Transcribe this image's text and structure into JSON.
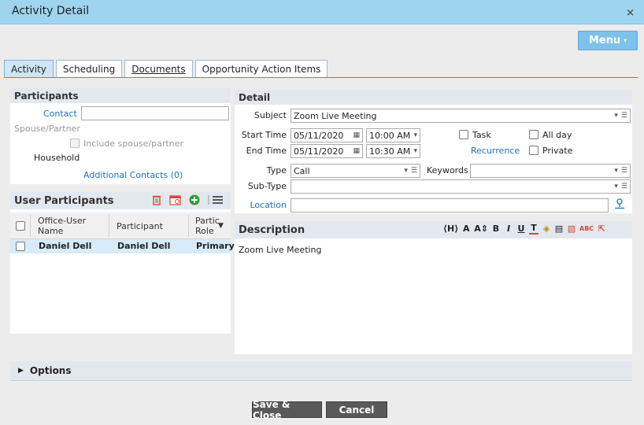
{
  "window": {
    "title": "Activity Detail",
    "close_glyph": "×"
  },
  "menu": {
    "label": "Menu",
    "caret": "▾"
  },
  "tabs": [
    {
      "label": "Activity",
      "active": true
    },
    {
      "label": "Scheduling"
    },
    {
      "label": "Documents"
    },
    {
      "label": "Opportunity Action Items"
    }
  ],
  "participants": {
    "header": "Participants",
    "contact_label": "Contact",
    "contact_value": "",
    "spouse_label": "Spouse/Partner",
    "include_spouse_label": "Include spouse/partner",
    "household_label": "Household",
    "additional_contacts": "Additional Contacts (0)"
  },
  "user_participants": {
    "header": "User Participants",
    "columns": [
      "Office-User Name",
      "Participant",
      "Partic Role"
    ],
    "col1_line1": "Office-User",
    "col1_line2": "Name",
    "col3_line1": "Partic",
    "col3_line2": "Role",
    "rows": [
      {
        "office_user": "Daniel Dell",
        "participant": "Daniel Dell",
        "role": "Primary"
      }
    ],
    "icons": [
      "trash-icon",
      "calendar-icon",
      "add-icon",
      "list-menu-icon"
    ]
  },
  "detail": {
    "header": "Detail",
    "subject_label": "Subject",
    "subject_value": "Zoom Live Meeting",
    "start_label": "Start Time",
    "start_date": "05/11/2020",
    "start_time": "10:00 AM",
    "end_label": "End Time",
    "end_date": "05/11/2020",
    "end_time": "10:30 AM",
    "task_label": "Task",
    "allday_label": "All day",
    "recurrence_label": "Recurrence",
    "private_label": "Private",
    "type_label": "Type",
    "type_value": "Call",
    "keywords_label": "Keywords",
    "keywords_value": "",
    "subtype_label": "Sub-Type",
    "subtype_value": "",
    "location_label": "Location",
    "location_value": ""
  },
  "description": {
    "header": "Description",
    "text": "Zoom Live Meeting",
    "tools": [
      "⟨H⟩",
      "A",
      "A⇕",
      "B",
      "I",
      "U",
      "T",
      "◈",
      "▤",
      "▧",
      "ABC",
      "⇱"
    ]
  },
  "options": {
    "label": "Options"
  },
  "footer": {
    "save_label": "Save & Close",
    "cancel_label": "Cancel"
  },
  "colors": {
    "titlebar": "#9fd4ef",
    "accent": "#7cc2ea",
    "link": "#1f6fb4",
    "row_highlight": "#d7ebf8"
  }
}
